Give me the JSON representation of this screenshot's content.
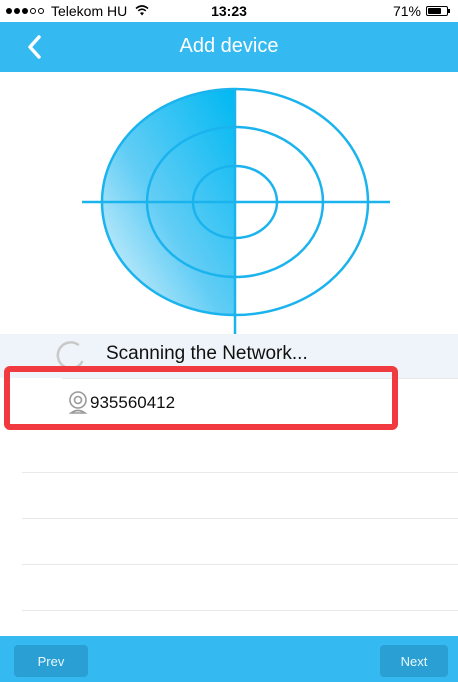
{
  "status_bar": {
    "carrier": "Telekom HU",
    "time": "13:23",
    "battery": "71%",
    "battery_level": 0.71,
    "signal_filled": 3,
    "signal_total": 5
  },
  "header": {
    "title": "Add device"
  },
  "scan": {
    "status_text": "Scanning the Network..."
  },
  "devices": [
    {
      "id": "935560412"
    }
  ],
  "footer": {
    "prev_label": "Prev",
    "next_label": "Next"
  },
  "colors": {
    "accent": "#34b9f0",
    "highlight": "#f03a3f",
    "button": "#2a9fd4"
  },
  "icons": {
    "back": "chevron-left-icon",
    "spinner": "loading-spinner-icon",
    "camera": "camera-icon"
  }
}
